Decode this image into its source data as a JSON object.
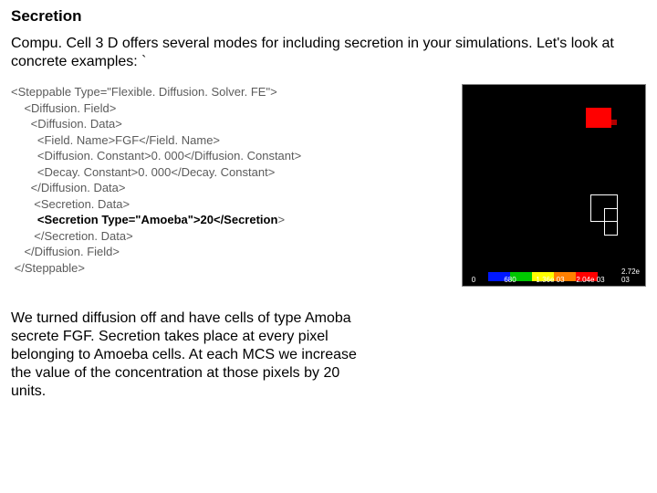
{
  "title": "Secretion",
  "intro": "Compu. Cell 3 D offers several modes for including secretion in your simulations. Let's look at concrete examples: `",
  "code": {
    "l01": "<Steppable Type=\"Flexible. Diffusion. Solver. FE\">",
    "l02": "    <Diffusion. Field>",
    "l03": "      <Diffusion. Data>",
    "l04": "        <Field. Name>FGF</Field. Name>",
    "l05": "        <Diffusion. Constant>0. 000</Diffusion. Constant>",
    "l06": "        <Decay. Constant>0. 000</Decay. Constant>",
    "l07": "      </Diffusion. Data>",
    "l08": "       <Secretion. Data>",
    "l09a": "        <Secretion Type=\"Amoeba\">20</Secretion",
    "l09b": ">",
    "l10": "       </Secretion. Data>",
    "l11": "    </Diffusion. Field>",
    "l12": " </Steppable>"
  },
  "explain": "We turned diffusion off and have cells of type Amoba secrete FGF. Secretion takes place at every pixel belonging to Amoeba cells. At each MCS we increase the value of the concentration at those pixels by 20 units.",
  "legend": {
    "ticks": {
      "t0": "0",
      "t1": "680",
      "t2": "1.36e 03",
      "t3": "2.04e 03",
      "t4": "2.72e 03"
    },
    "colors": {
      "c0": "#000000",
      "c1": "#0018ff",
      "c2": "#00c800",
      "c3": "#ffff00",
      "c4": "#ff8000",
      "c5": "#ff0000"
    }
  }
}
